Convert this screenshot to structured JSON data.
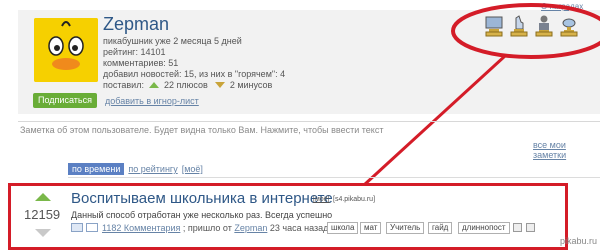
{
  "profile": {
    "username": "Zepman",
    "stats": [
      "пикабушник уже 2 месяца 5 дней",
      "рейтинг: 14101",
      "комментариев: 51",
      "добавил новостей: 15, из них в \"горячем\": 4"
    ],
    "votes_label": "поставил:",
    "plus_count": "22 плюсов",
    "minus_count": "2 минусов",
    "subscribe_label": "Подписаться",
    "ignore_label": "добавить в игнор-лист",
    "awards_link": "О наградах",
    "award_icons": [
      "trophy-computer-icon",
      "trophy-hand-icon",
      "trophy-person-icon",
      "trophy-dish-icon"
    ]
  },
  "note": {
    "text": "Заметка об этом пользователе. Будет видна только Вам. Нажмите, чтобы ввести текст",
    "my_notes_label": "все мои заметки"
  },
  "sort_tabs": {
    "by_time": "по времени",
    "by_rating": "по рейтингу",
    "mine": "[моё]"
  },
  "post": {
    "rating": "12159",
    "title": "Воспитываем школьника в интернете",
    "mine_tag": "[моё]",
    "source": "[s4.pikabu.ru]",
    "description": "Данный способ отработан уже несколько раз. Всегда успешно",
    "comments_link": "1182 Комментария",
    "posted_prefix": "; пришло от",
    "author": "Zepman",
    "time_ago": "23 часа назад",
    "tags": [
      "школа",
      "мат",
      "Учитель",
      "гайд",
      "длиннопост"
    ]
  },
  "watermark": "pikabu.ru",
  "colors": {
    "accent_blue": "#2f5887",
    "highlight_red": "#d41c28",
    "subscribe_green": "#69ad37",
    "avatar_yellow": "#f6d000"
  }
}
